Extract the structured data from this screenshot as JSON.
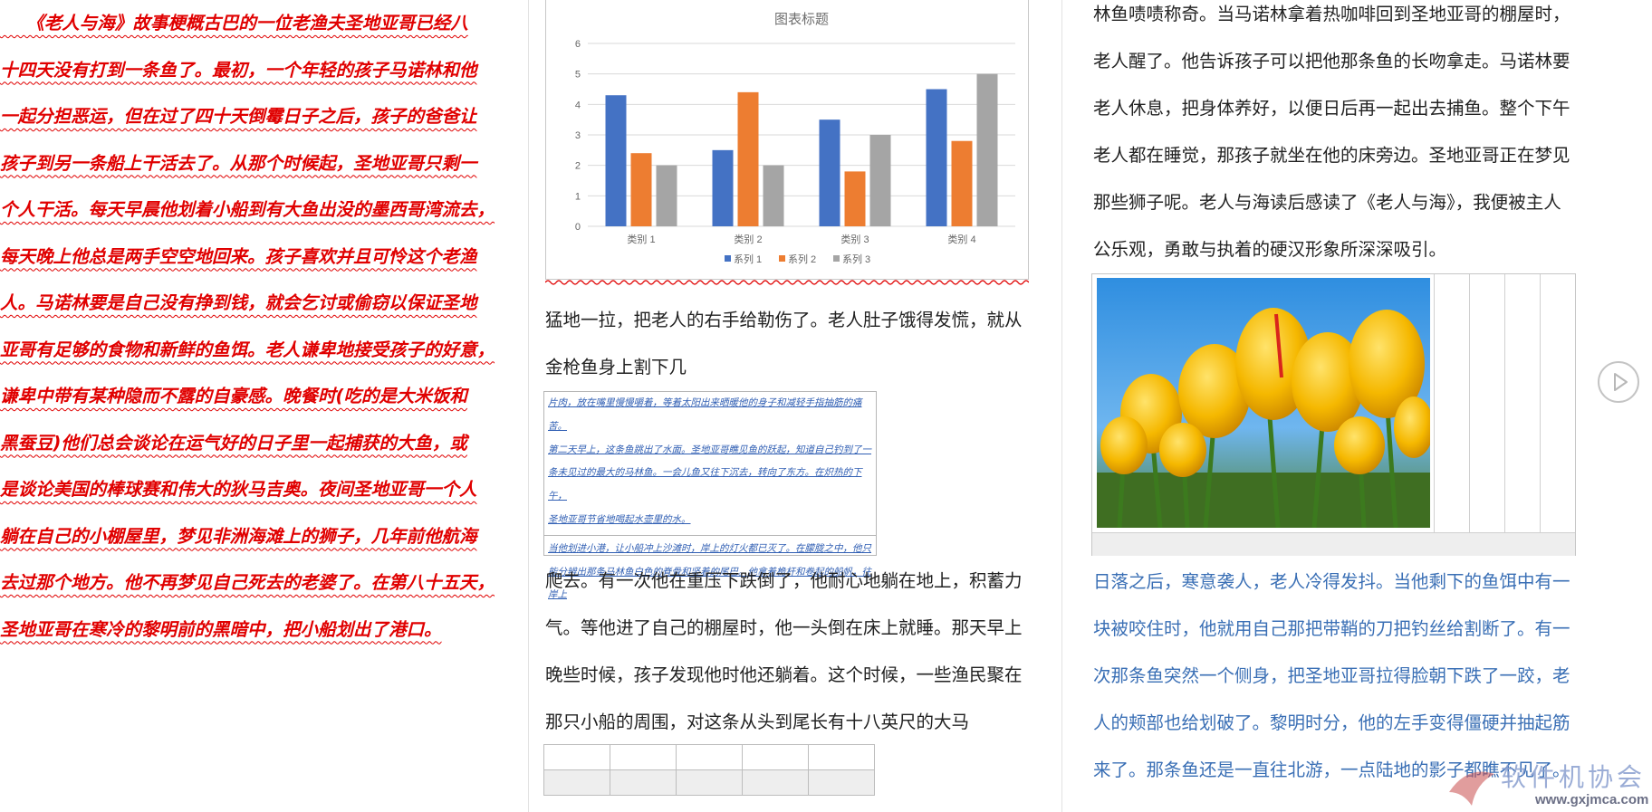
{
  "column1": {
    "lines": [
      "　　《老人与海》故事梗概古巴的一位老渔夫圣地亚哥已经八",
      "十四天没有打到一条鱼了。最初，一个年轻的孩子马诺林和他",
      "一起分担恶运，但在过了四十天倒霉日子之后，孩子的爸爸让",
      "孩子到另一条船上干活去了。从那个时候起，圣地亚哥只剩一",
      "个人干活。每天早晨他划着小船到有大鱼出没的墨西哥湾流去，",
      "每天晚上他总是两手空空地回来。孩子喜欢并且可怜这个老渔",
      "人。马诺林要是自己没有挣到钱，就会乞讨或偷窃以保证圣地",
      "亚哥有足够的食物和新鲜的鱼饵。老人谦卑地接受孩子的好意，",
      "谦卑中带有某种隐而不露的自豪感。晚餐时(吃的是大米饭和",
      "黑蚕豆)他们总会谈论在运气好的日子里一起捕获的大鱼，或",
      "是谈论美国的棒球赛和伟大的狄马吉奥。夜间圣地亚哥一个人",
      "躺在自己的小棚屋里，梦见非洲海滩上的狮子，几年前他航海",
      "去过那个地方。他不再梦见自己死去的老婆了。在第八十五天，",
      "圣地亚哥在寒冷的黎明前的黑暗中，把小船划出了港口。"
    ]
  },
  "column2": {
    "para1": [
      "猛地一拉，把老人的右手给勒伤了。老人肚子饿得发慌，就从",
      "金枪鱼身上割下几"
    ],
    "note": {
      "section1": [
        "片肉，放在嘴里慢慢嚼着，等着太阳出来晒暖他的身子和减轻手指抽筋的痛苦。",
        "第二天早上，这条鱼跳出了水面。圣地亚哥瞧见鱼的跃起，知道自己钓到了一",
        "条未见过的最大的马林鱼。一会儿鱼又往下沉去，转向了东方。在炽热的下午，",
        "圣地亚哥节省地喝起水壶里的水。"
      ],
      "section2": [
        "当他划进小港，让小船冲上沙滩时，岸上的灯火都已灭了。在朦胧之中，他只",
        "能分辨出那条马林鱼白色的脊骨和竖着的尾巴。他拿着桅杆和卷起的船帆，往",
        "岸上"
      ]
    },
    "para2": [
      "爬去。有一次他在重压下跌倒了，他耐心地躺在地上，积蓄力",
      "气。等他进了自己的棚屋时，他一头倒在床上就睡。那天早上",
      "晚些时候，孩子发现他时他还躺着。这个时候，一些渔民聚在",
      "那只小船的周围，对这条从头到尾长有十八英尺的大马"
    ]
  },
  "column3": {
    "para1": [
      "林鱼啧啧称奇。当马诺林拿着热咖啡回到圣地亚哥的棚屋时，",
      "老人醒了。他告诉孩子可以把他那条鱼的长吻拿走。马诺林要",
      "老人休息，把身体养好，以便日后再一起出去捕鱼。整个下午",
      "老人都在睡觉，那孩子就坐在他的床旁边。圣地亚哥正在梦见",
      "那些狮子呢。老人与海读后感读了《老人与海》，我便被主人",
      "公乐观，勇敢与执着的硬汉形象所深深吸引。"
    ],
    "para2": [
      "日落之后，寒意袭人，老人冷得发抖。当他剩下的鱼饵中有一",
      "块被咬住时，他就用自己那把带鞘的刀把钓丝给割断了。有一",
      "次那条鱼突然一个侧身，把圣地亚哥拉得脸朝下跌了一跤，老",
      "人的颊部也给划破了。黎明时分，他的左手变得僵硬并抽起筋",
      "来了。那条鱼还是一直往北游，一点陆地的影子都瞧不见了。"
    ]
  },
  "chart_data": {
    "type": "bar",
    "title": "图表标题",
    "categories": [
      "类别 1",
      "类别 2",
      "类别 3",
      "类别 4"
    ],
    "series": [
      {
        "name": "系列 1",
        "values": [
          4.3,
          2.5,
          3.5,
          4.5
        ],
        "color": "#4472c4"
      },
      {
        "name": "系列 2",
        "values": [
          2.4,
          4.4,
          1.8,
          2.8
        ],
        "color": "#ed7d31"
      },
      {
        "name": "系列 3",
        "values": [
          2,
          2,
          3,
          5
        ],
        "color": "#a5a5a5"
      }
    ],
    "ylim": [
      0,
      6
    ],
    "yticks": [
      "0",
      "1",
      "2",
      "3",
      "4",
      "5",
      "6"
    ],
    "grid": true,
    "legend": "bottom"
  },
  "watermark": {
    "text": "软件机协会",
    "url": "www.gxjmca.com"
  },
  "icons": {
    "next": "play-circle-icon",
    "image": "tulips-photo"
  }
}
